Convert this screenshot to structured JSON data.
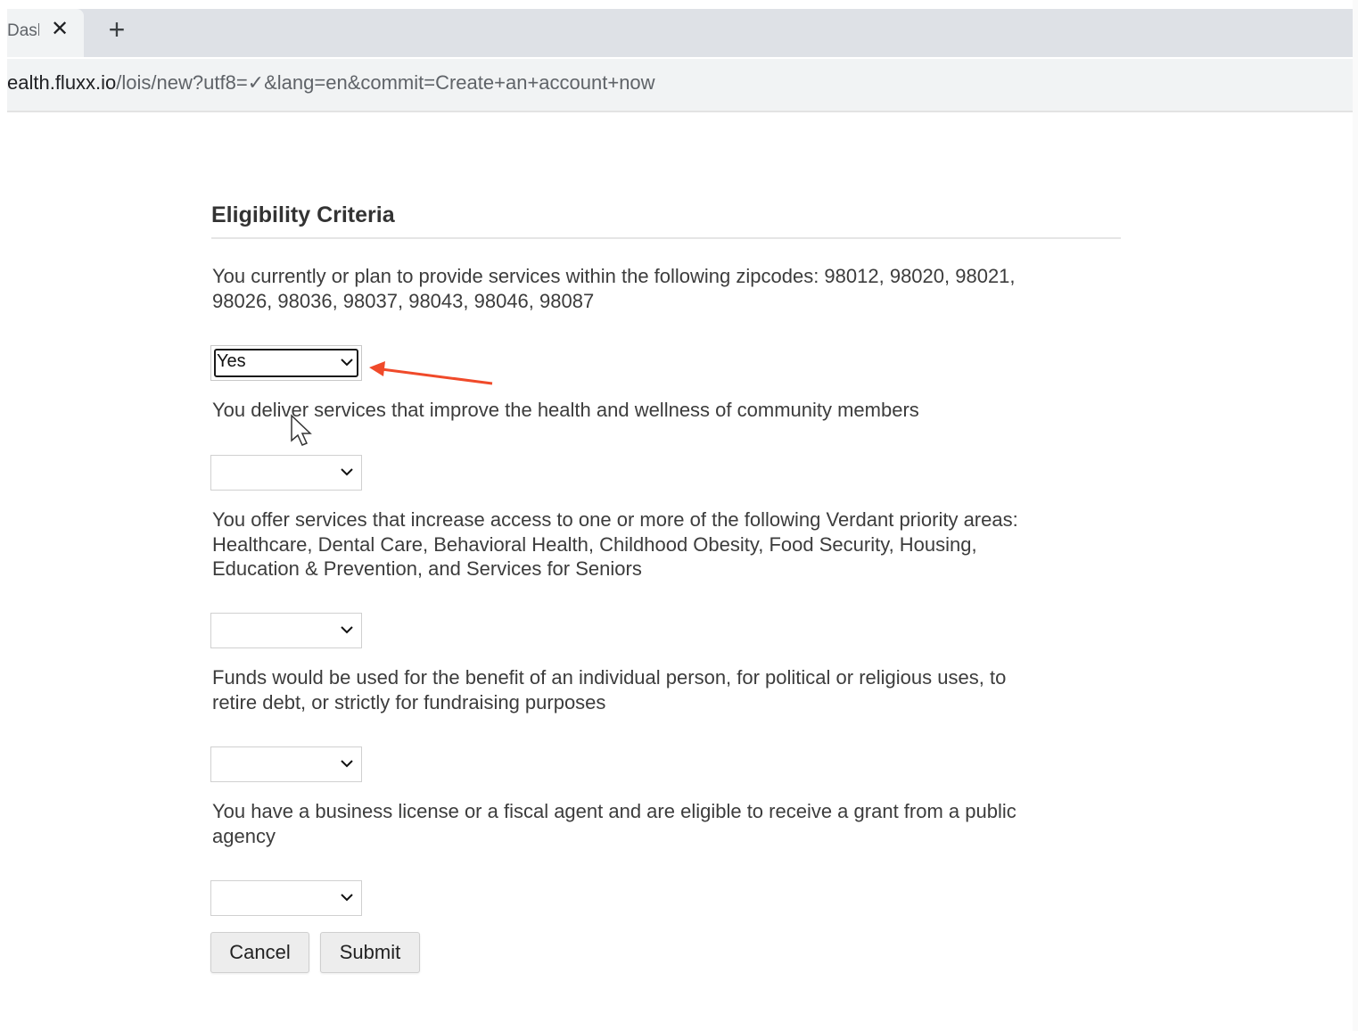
{
  "browser": {
    "tab_title": "Dash",
    "close_glyph": "✕",
    "new_tab_glyph": "+",
    "url_host": "ealth.fluxx.io",
    "url_path": "/lois/new?utf8=✓&lang=en&commit=Create+an+account+now"
  },
  "form": {
    "title": "Eligibility Criteria",
    "questions": [
      {
        "text": "You currently or plan to provide services within the following zipcodes: 98012, 98020, 98021, 98026, 98036, 98037, 98043, 98046, 98087",
        "selected": "Yes"
      },
      {
        "text": "You deliver services that improve the health and wellness of community members",
        "selected": ""
      },
      {
        "text": "You offer services that increase access to one or more of the following Verdant priority areas: Healthcare, Dental Care, Behavioral Health, Childhood Obesity, Food Security, Housing, Education & Prevention, and Services for Seniors",
        "selected": ""
      },
      {
        "text": "Funds would be used for the benefit of an individual person, for political or religious uses, to retire debt, or strictly for fundraising purposes",
        "selected": ""
      },
      {
        "text": "You have a business license or a fiscal agent and are eligible to receive a grant from a public agency",
        "selected": ""
      }
    ],
    "cancel_label": "Cancel",
    "submit_label": "Submit"
  },
  "annotation": {
    "arrow_color": "#f04a2a"
  },
  "icons": {
    "dropdown": "chevron-down-icon",
    "pointer": "mouse-pointer-icon",
    "close": "close-icon",
    "add": "plus-icon"
  }
}
